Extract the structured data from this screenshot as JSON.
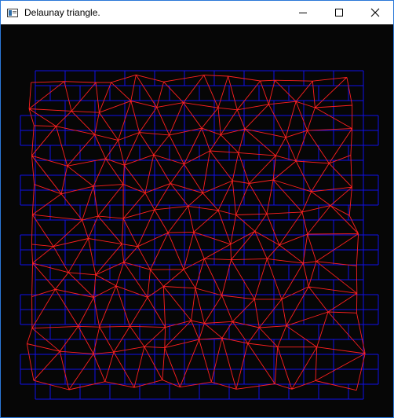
{
  "window": {
    "title": "Delaunay triangle.",
    "icons": {
      "app": "app-window-icon",
      "minimize": "minimize-icon",
      "maximize": "maximize-icon",
      "close": "close-icon"
    }
  },
  "colors": {
    "titlebar_bg": "#ffffff",
    "window_border": "#2b78d8",
    "canvas_bg": "#060606",
    "grid": "#1010e8",
    "triangles": "#ff2020"
  }
}
